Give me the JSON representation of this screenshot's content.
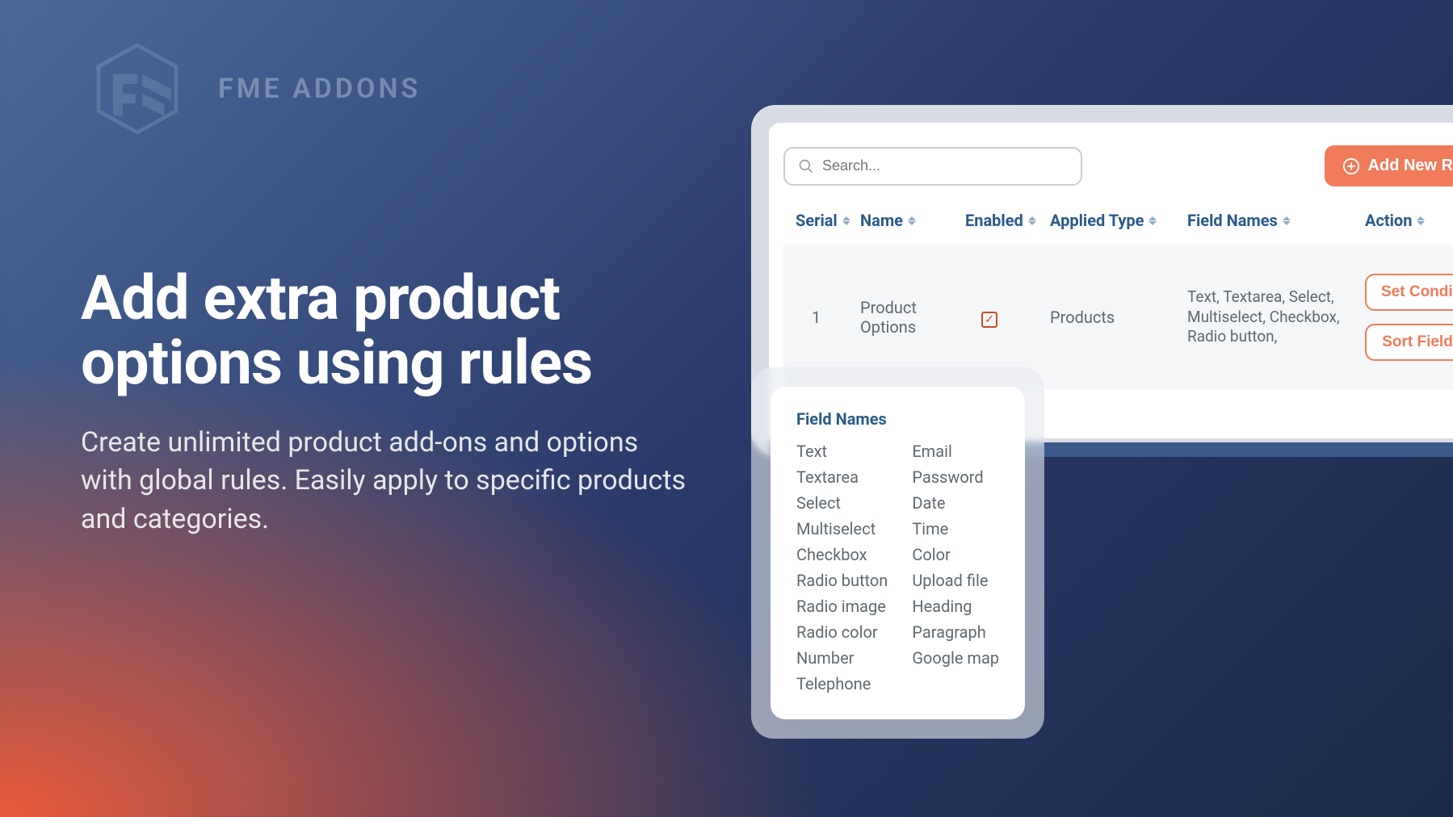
{
  "brand": "FME ADDONS",
  "hero": {
    "title": "Add extra product options using rules",
    "subtitle": "Create unlimited product add-ons and options with global rules. Easily apply to specific products and categories."
  },
  "search": {
    "placeholder": "Search..."
  },
  "add_role_label": "Add New Role",
  "columns": {
    "serial": "Serial",
    "name": "Name",
    "enabled": "Enabled",
    "applied_type": "Applied Type",
    "field_names": "Field Names",
    "action": "Action"
  },
  "rows": [
    {
      "serial": "1",
      "name": "Product Options",
      "enabled": true,
      "applied_type": "Products",
      "field_names": "Text, Textarea, Select, Multiselect, Checkbox, Radio button,",
      "actions": {
        "set_conditions": "Set Conditions",
        "sort_field": "Sort Field"
      }
    }
  ],
  "popup": {
    "title": "Field Names",
    "col1": [
      "Text",
      "Textarea",
      "Select",
      "Multiselect",
      "Checkbox",
      "Radio button",
      "Radio image",
      "Radio color",
      "Number",
      "Telephone"
    ],
    "col2": [
      "Email",
      "Password",
      "Date",
      "Time",
      "Color",
      "Upload file",
      "Heading",
      "Paragraph",
      "Google map"
    ]
  }
}
